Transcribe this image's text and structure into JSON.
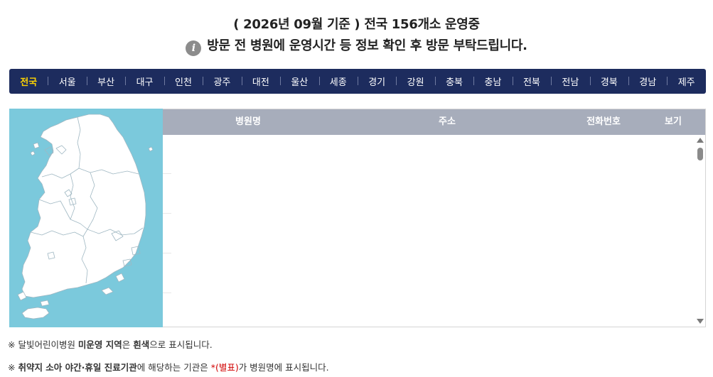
{
  "header": {
    "title_line1": "( 2026년 09월 기준 ) 전국 156개소 운영중",
    "info_icon": "i",
    "title_line2": "방문 전 병원에 운영시간 등 정보 확인 후 방문 부탁드립니다."
  },
  "regions": [
    {
      "label": "전국",
      "active": true
    },
    {
      "label": "서울"
    },
    {
      "label": "부산"
    },
    {
      "label": "대구"
    },
    {
      "label": "인천"
    },
    {
      "label": "광주"
    },
    {
      "label": "대전"
    },
    {
      "label": "울산"
    },
    {
      "label": "세종"
    },
    {
      "label": "경기"
    },
    {
      "label": "강원"
    },
    {
      "label": "충북"
    },
    {
      "label": "충남"
    },
    {
      "label": "전북"
    },
    {
      "label": "전남"
    },
    {
      "label": "경북"
    },
    {
      "label": "경남"
    },
    {
      "label": "제주"
    }
  ],
  "table": {
    "columns": [
      "병원명",
      "주소",
      "전화번호",
      "보기"
    ],
    "rows": []
  },
  "notes": {
    "note1": {
      "prefix": "※ 달빛어린이병원 ",
      "bold1": "미운영 지역",
      "mid": "은 ",
      "bold2": "흰색",
      "suffix": "으로 표시됩니다."
    },
    "note2": {
      "prefix": "※ ",
      "bold1": "취약지 소아 야간·휴일 진료기관",
      "mid": "에 해당하는 기관은 ",
      "red": "*(별표)",
      "suffix": "가 병원명에 표시됩니다."
    }
  },
  "colors": {
    "nav_bg": "#1d2c5e",
    "nav_active": "#ffd400",
    "map_sea": "#7bc9dc",
    "table_header": "#a7adbb",
    "note_red": "#d10000"
  }
}
